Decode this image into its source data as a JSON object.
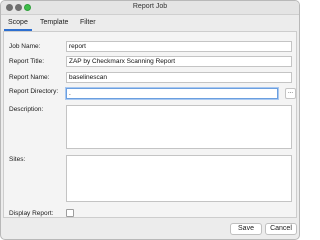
{
  "window": {
    "title": "Report Job"
  },
  "tabs": [
    {
      "label": "Scope"
    },
    {
      "label": "Template"
    },
    {
      "label": "Filter"
    }
  ],
  "form": {
    "job_name": {
      "label": "Job Name:",
      "value": "report"
    },
    "report_title": {
      "label": "Report Title:",
      "value": "ZAP by Checkmarx Scanning Report"
    },
    "report_name": {
      "label": "Report Name:",
      "value": "baselinescan"
    },
    "report_directory": {
      "label": "Report Directory:",
      "value": ".",
      "browse_label": "..."
    },
    "description": {
      "label": "Description:",
      "value": ""
    },
    "sites": {
      "label": "Sites:",
      "value": ""
    },
    "display_report": {
      "label": "Display Report:",
      "checked": false
    }
  },
  "buttons": {
    "save": "Save",
    "cancel": "Cancel"
  },
  "colors": {
    "tab_accent": "#2d6fd0",
    "focus_border": "#6b9fe0",
    "maximize": "#3fbd4a"
  }
}
